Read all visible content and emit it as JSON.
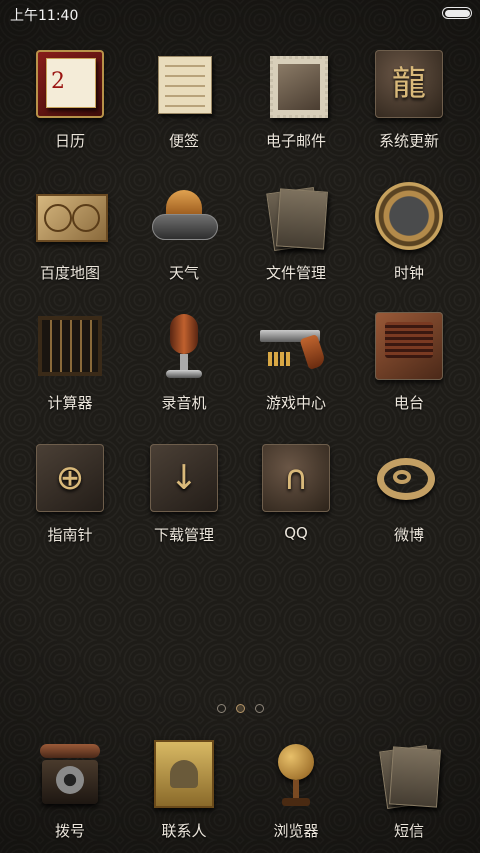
{
  "status_bar": {
    "time": "上午11:40",
    "battery_level_percent": 100
  },
  "home_screen": {
    "apps": [
      {
        "label": "日历",
        "icon": "calendar-icon",
        "date_number": "2"
      },
      {
        "label": "便签",
        "icon": "notepad-icon"
      },
      {
        "label": "电子邮件",
        "icon": "stamp-mail-icon"
      },
      {
        "label": "系统更新",
        "icon": "dragon-plaque-icon"
      },
      {
        "label": "百度地图",
        "icon": "world-map-icon"
      },
      {
        "label": "天气",
        "icon": "sun-cloud-icon"
      },
      {
        "label": "文件管理",
        "icon": "file-folders-icon"
      },
      {
        "label": "时钟",
        "icon": "ornate-clock-icon"
      },
      {
        "label": "计算器",
        "icon": "abacus-icon"
      },
      {
        "label": "录音机",
        "icon": "microphone-icon"
      },
      {
        "label": "游戏中心",
        "icon": "revolver-icon"
      },
      {
        "label": "电台",
        "icon": "vintage-radio-icon"
      },
      {
        "label": "指南针",
        "icon": "compass-plaque-icon"
      },
      {
        "label": "下载管理",
        "icon": "download-plaque-icon"
      },
      {
        "label": "QQ",
        "icon": "qq-penguin-icon"
      },
      {
        "label": "微博",
        "icon": "weibo-icon"
      }
    ]
  },
  "page_indicator": {
    "pages": 3,
    "current": 2
  },
  "dock": {
    "apps": [
      {
        "label": "拨号",
        "icon": "rotary-phone-icon"
      },
      {
        "label": "联系人",
        "icon": "contacts-book-icon"
      },
      {
        "label": "浏览器",
        "icon": "globe-icon"
      },
      {
        "label": "短信",
        "icon": "letters-icon"
      }
    ]
  },
  "colors": {
    "label": "#ece6dc",
    "accent_bronze": "#c4a064",
    "background": "#1e1c18"
  }
}
